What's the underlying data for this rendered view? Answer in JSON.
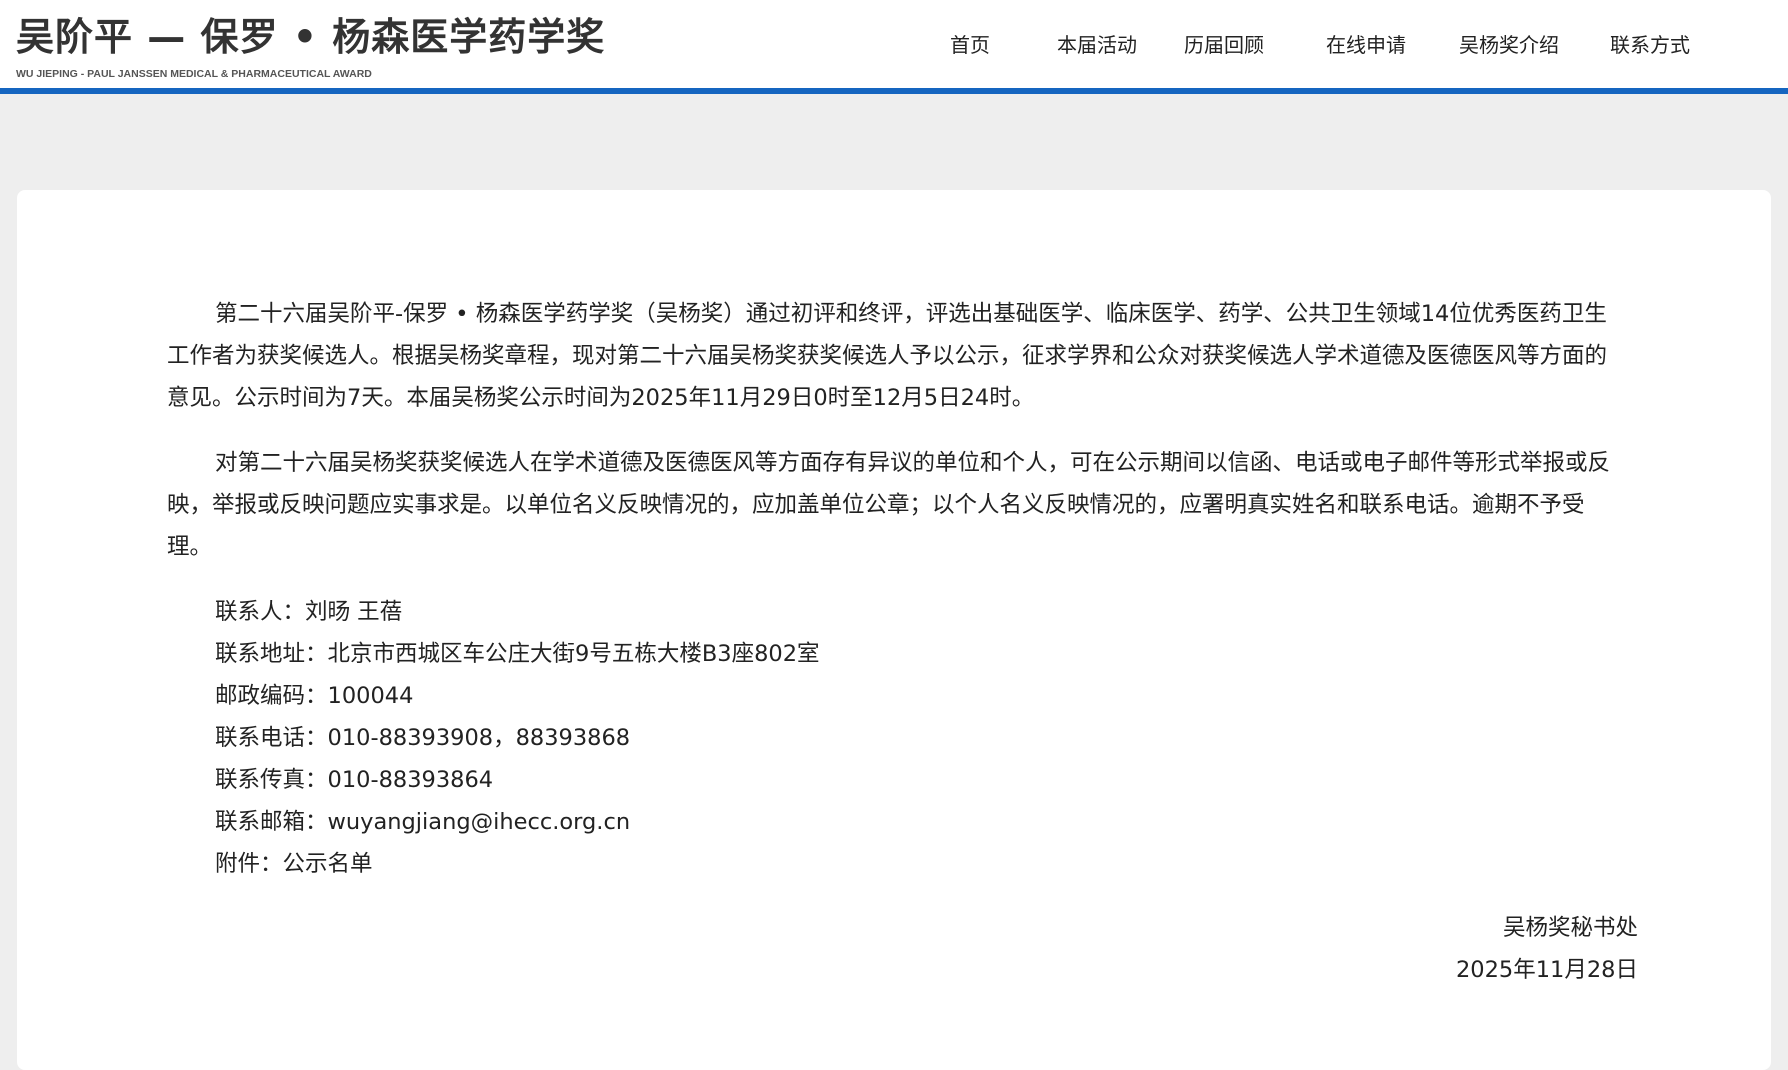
{
  "header": {
    "brand_title": "吴阶平 — 保罗 • 杨森医学药学奖",
    "brand_subtitle": "WU JIEPING - PAUL JANSSEN MEDICAL & PHARMACEUTICAL AWARD",
    "nav": [
      "首页",
      "本届活动",
      "历届回顾",
      "在线申请",
      "吴杨奖介绍",
      "联系方式"
    ],
    "accent_color": "#1565c0"
  },
  "notice": {
    "paragraphs": [
      "第二十六届吴阶平-保罗 • 杨森医学药学奖（吴杨奖）通过初评和终评，评选出基础医学、临床医学、药学、公共卫生领域14位优秀医药卫生工作者为获奖候选人。根据吴杨奖章程，现对第二十六届吴杨奖获奖候选人予以公示，征求学界和公众对获奖候选人学术道德及医德医风等方面的意见。公示时间为7天。本届吴杨奖公示时间为2025年11月29日0时至12月5日24时。",
      "对第二十六届吴杨奖获奖候选人在学术道德及医德医风等方面存有异议的单位和个人，可在公示期间以信函、电话或电子邮件等形式举报或反映，举报或反映问题应实事求是。以单位名义反映情况的，应加盖单位公章；以个人名义反映情况的，应署明真实姓名和联系电话。逾期不予受理。"
    ],
    "contact": {
      "person": "联系人：刘旸 王蓓",
      "address": "联系地址：北京市西城区车公庄大街9号五栋大楼B3座802室",
      "postcode": "邮政编码：100044",
      "phone": "联系电话：010-88393908，88393868",
      "fax": "联系传真：010-88393864",
      "email": "联系邮箱：wuyangjiang@ihecc.org.cn",
      "attachment": "附件：公示名单"
    },
    "signature": {
      "org": "吴杨奖秘书处",
      "date": "2025年11月28日"
    }
  }
}
